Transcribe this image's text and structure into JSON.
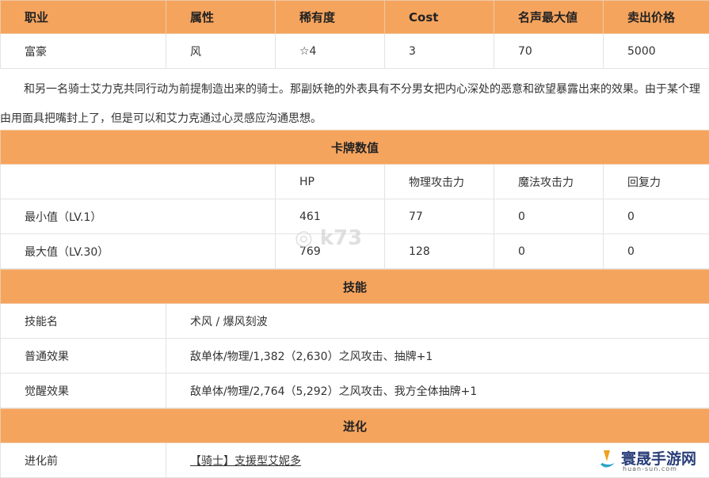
{
  "header": [
    "职业",
    "属性",
    "稀有度",
    "Cost",
    "名声最大値",
    "卖出价格"
  ],
  "info": [
    "富豪",
    "风",
    "☆4",
    "3",
    "70",
    "5000"
  ],
  "description": "和另一名骑士艾力克共同行动为前提制造出来的骑士。那副妖艳的外表具有不分男女把内心深处的恶意和欲望暴露出来的效果。由于某个理由用面具把嘴封上了，但是可以和艾力克通过心灵感应沟通思想。",
  "card": {
    "title": "卡牌数值",
    "columns": [
      "HP",
      "物理攻击力",
      "魔法攻击力",
      "回复力"
    ],
    "rows": [
      {
        "label": "最小值（LV.1）",
        "values": [
          "461",
          "77",
          "0",
          "0"
        ]
      },
      {
        "label": "最大值（LV.30）",
        "values": [
          "769",
          "128",
          "0",
          "0"
        ]
      }
    ]
  },
  "skill": {
    "title": "技能",
    "rows": [
      {
        "label": "技能名",
        "value": "术风 / 爆风刻波"
      },
      {
        "label": "普通效果",
        "value": "敌单体/物理/1,382（2,630）之风攻击、抽牌+1"
      },
      {
        "label": "觉醒效果",
        "value": "敌单体/物理/2,764（5,292）之风攻击、我方全体抽牌+1"
      }
    ]
  },
  "evolution": {
    "title": "进化",
    "label": "进化前",
    "value": "【骑士】支援型艾妮多"
  },
  "watermark": "k73",
  "logo": {
    "name": "寰晟手游网",
    "url": "huan-sun.com"
  }
}
